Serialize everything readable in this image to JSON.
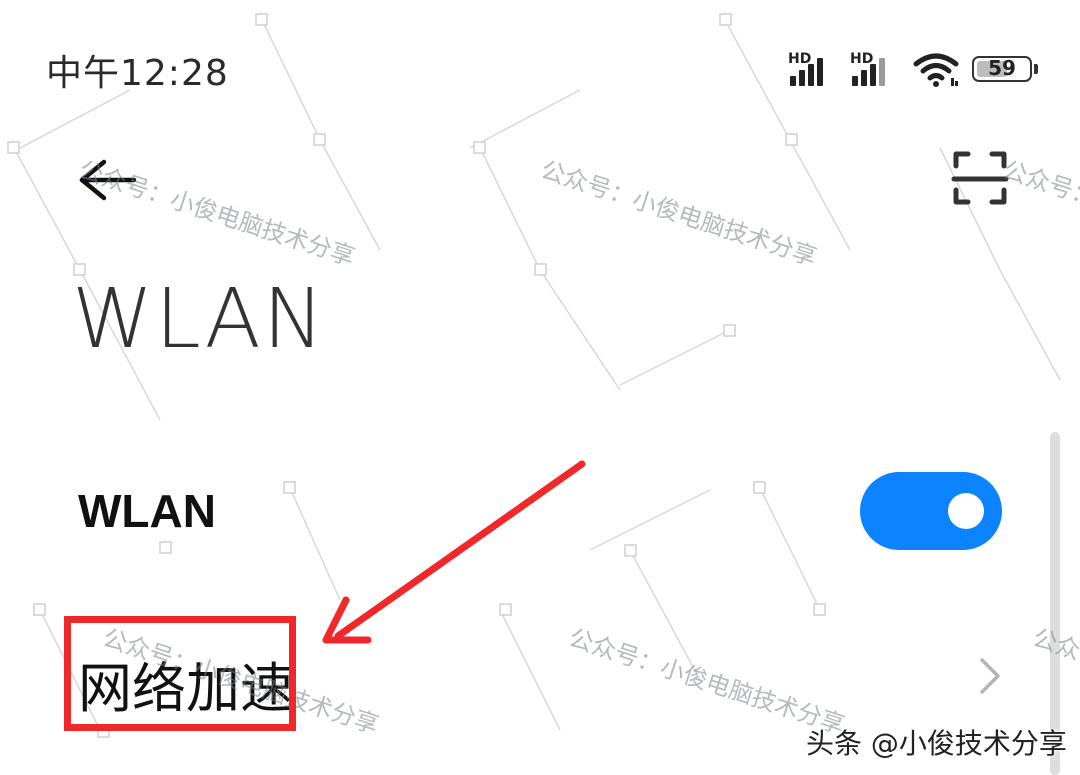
{
  "status_bar": {
    "time": "中午12:28",
    "sim1_label": "HD",
    "sim2_label": "HD",
    "battery_level": "59",
    "battery_fraction": 0.59,
    "icons": [
      "signal-icon",
      "signal-icon",
      "wifi-icon",
      "battery-icon"
    ]
  },
  "header": {
    "back_icon": "back-arrow-icon",
    "scan_icon": "scan-icon",
    "title": "WLAN"
  },
  "settings": {
    "wlan": {
      "label": "WLAN",
      "enabled": true
    },
    "network_acceleration": {
      "label": "网络加速",
      "icon": "chevron-right-icon"
    }
  },
  "watermark": {
    "text": "公众号：小俊电脑技术分享"
  },
  "credit": {
    "text": "头条 @小俊技术分享"
  },
  "colors": {
    "toggle_on": "#0d84ff",
    "annotation": "#f0282a",
    "background": "#ffffff"
  }
}
